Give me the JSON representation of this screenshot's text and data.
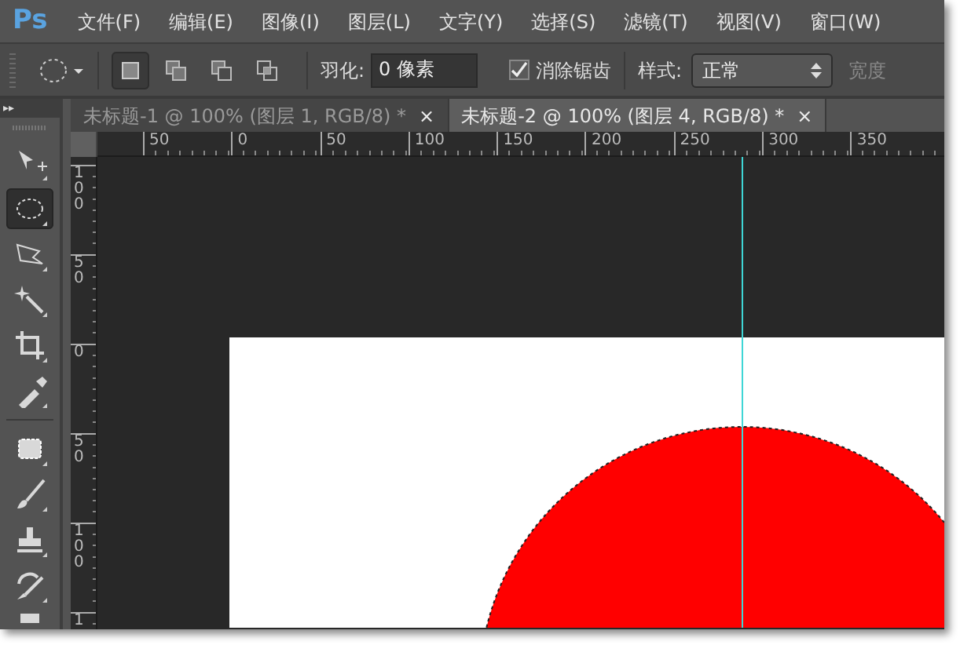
{
  "menu_bar": {
    "logo": "Ps",
    "items": [
      "文件(F)",
      "编辑(E)",
      "图像(I)",
      "图层(L)",
      "文字(Y)",
      "选择(S)",
      "滤镜(T)",
      "视图(V)",
      "窗口(W)"
    ]
  },
  "options_bar": {
    "selection_modes": [
      {
        "kind": "new",
        "selected": true
      },
      {
        "kind": "add",
        "selected": false
      },
      {
        "kind": "subtract",
        "selected": false
      },
      {
        "kind": "intersect",
        "selected": false
      }
    ],
    "feather_label": "羽化:",
    "feather_value": "0 像素",
    "anti_alias": {
      "label": "消除锯齿",
      "checked": true
    },
    "style_label": "样式:",
    "style_value": "正常",
    "width_label": "宽度"
  },
  "panel_toggle": "▸▸",
  "tools": [
    {
      "kind": "move",
      "selected": false
    },
    {
      "kind": "ellipse",
      "selected": true
    },
    {
      "kind": "lasso",
      "selected": false
    },
    {
      "kind": "wand",
      "selected": false
    },
    {
      "kind": "crop",
      "selected": false
    },
    {
      "kind": "eyedropper",
      "selected": false
    },
    {
      "kind": "patch",
      "selected": false
    },
    {
      "kind": "brush",
      "selected": false
    },
    {
      "kind": "stamp",
      "selected": false
    },
    {
      "kind": "history",
      "selected": false
    },
    {
      "kind": "eraser",
      "selected": false
    }
  ],
  "tabs": [
    {
      "label": "未标题-1 @ 100% (图层 1, RGB/8) *",
      "close": "×",
      "selected": false
    },
    {
      "label": "未标题-2 @ 100% (图层 4, RGB/8) *",
      "close": "×",
      "selected": true
    }
  ],
  "horizontal_ruler": [
    "50",
    "0",
    "50",
    "100",
    "150",
    "200",
    "250",
    "300",
    "350"
  ],
  "vertical_ruler": [
    "100",
    "50",
    "0",
    "50",
    "100",
    "1"
  ]
}
